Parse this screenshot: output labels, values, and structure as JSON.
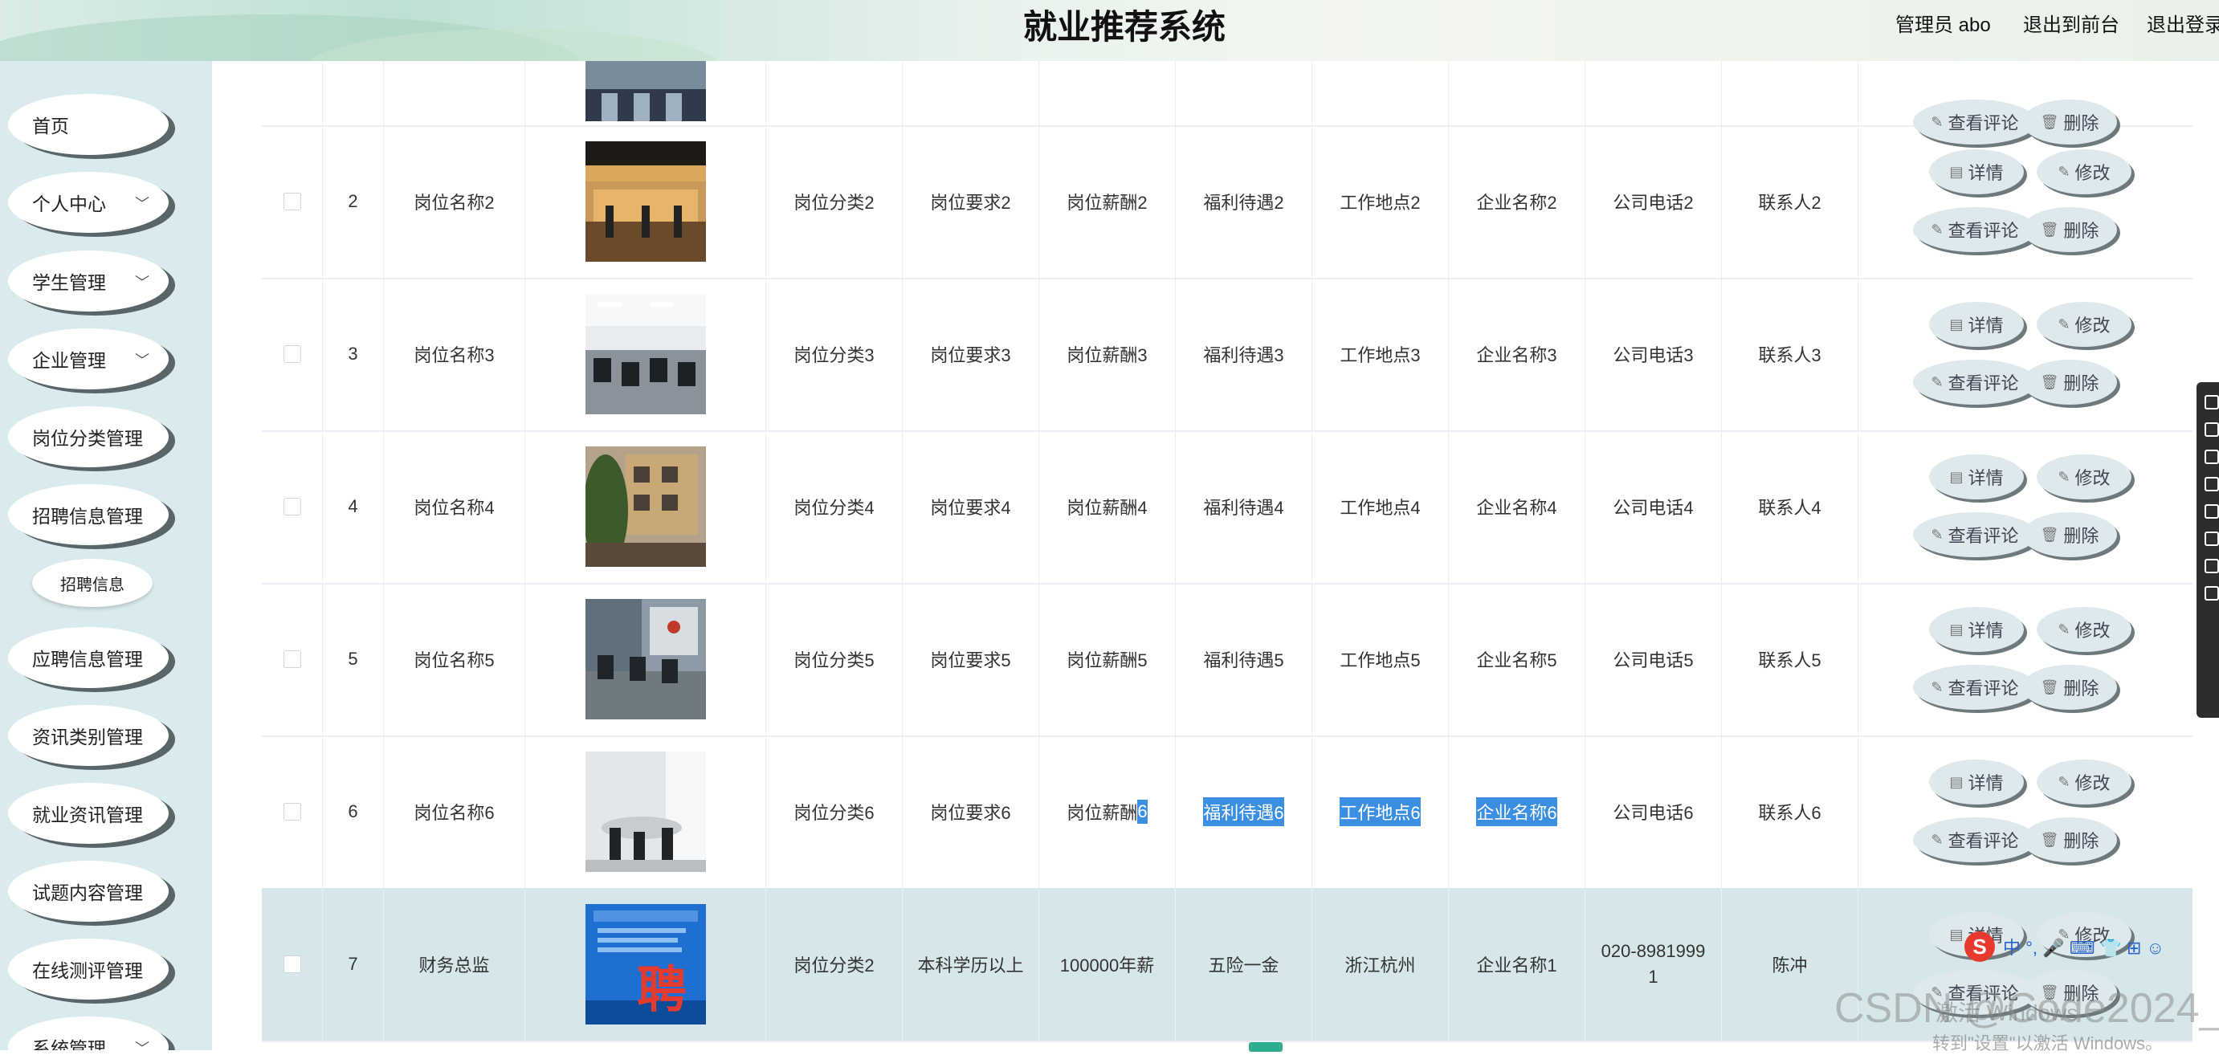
{
  "header": {
    "title": "就业推荐系统",
    "admin_label": "管理员 abo",
    "back_label": "退出到前台",
    "logout_label": "退出登录"
  },
  "sidebar": {
    "items": [
      {
        "label": "首页",
        "expandable": false
      },
      {
        "label": "个人中心",
        "expandable": true
      },
      {
        "label": "学生管理",
        "expandable": true
      },
      {
        "label": "企业管理",
        "expandable": true
      },
      {
        "label": "岗位分类管理",
        "expandable": false
      },
      {
        "label": "招聘信息管理",
        "expandable": false
      },
      {
        "label": "应聘信息管理",
        "expandable": false
      },
      {
        "label": "资讯类别管理",
        "expandable": false
      },
      {
        "label": "就业资讯管理",
        "expandable": false
      },
      {
        "label": "试题内容管理",
        "expandable": false
      },
      {
        "label": "在线测评管理",
        "expandable": false
      },
      {
        "label": "系统管理",
        "expandable": true
      }
    ],
    "sub_item": "招聘信息"
  },
  "table": {
    "buttons": {
      "detail": "详情",
      "edit": "修改",
      "comments": "查看评论",
      "delete": "删除"
    },
    "rows": [
      {
        "index": "2",
        "name": "岗位名称2",
        "category": "岗位分类2",
        "requirement": "岗位要求2",
        "salary": "岗位薪酬2",
        "benefits": "福利待遇2",
        "location": "工作地点2",
        "company": "企业名称2",
        "phone": "公司电话2",
        "contact": "联系人2"
      },
      {
        "index": "3",
        "name": "岗位名称3",
        "category": "岗位分类3",
        "requirement": "岗位要求3",
        "salary": "岗位薪酬3",
        "benefits": "福利待遇3",
        "location": "工作地点3",
        "company": "企业名称3",
        "phone": "公司电话3",
        "contact": "联系人3"
      },
      {
        "index": "4",
        "name": "岗位名称4",
        "category": "岗位分类4",
        "requirement": "岗位要求4",
        "salary": "岗位薪酬4",
        "benefits": "福利待遇4",
        "location": "工作地点4",
        "company": "企业名称4",
        "phone": "公司电话4",
        "contact": "联系人4"
      },
      {
        "index": "5",
        "name": "岗位名称5",
        "category": "岗位分类5",
        "requirement": "岗位要求5",
        "salary": "岗位薪酬5",
        "benefits": "福利待遇5",
        "location": "工作地点5",
        "company": "企业名称5",
        "phone": "公司电话5",
        "contact": "联系人5"
      },
      {
        "index": "6",
        "name": "岗位名称6",
        "category": "岗位分类6",
        "requirement": "岗位要求6",
        "salary_prefix": "岗位薪酬",
        "salary_selected": "6",
        "benefits": "福利待遇6",
        "location": "工作地点6",
        "company": "企业名称6",
        "phone": "公司电话6",
        "contact": "联系人6"
      },
      {
        "index": "7",
        "name": "财务总监",
        "category": "岗位分类2",
        "requirement": "本科学历以上",
        "salary": "100000年薪",
        "benefits": "五险一金",
        "location": "浙江杭州",
        "company": "企业名称1",
        "phone": "020-8981999 1",
        "contact": "陈冲"
      }
    ],
    "poster_char": "聘"
  },
  "overlay": {
    "watermark_csdn": "CSDN @Code2024_",
    "windows_activate": "激活 Windows",
    "windows_hint": "转到\"设置\"以激活 Windows。",
    "ime_logo": "S",
    "ime_text": "中 °, 🎤 ⌨ 👕 ⊞ ☺"
  },
  "colors": {
    "sidebar_bg": "#d9ebee",
    "highlight_row": "#d5e7ea",
    "selection": "#3b8fe2",
    "pager_active": "#2fae8f"
  }
}
